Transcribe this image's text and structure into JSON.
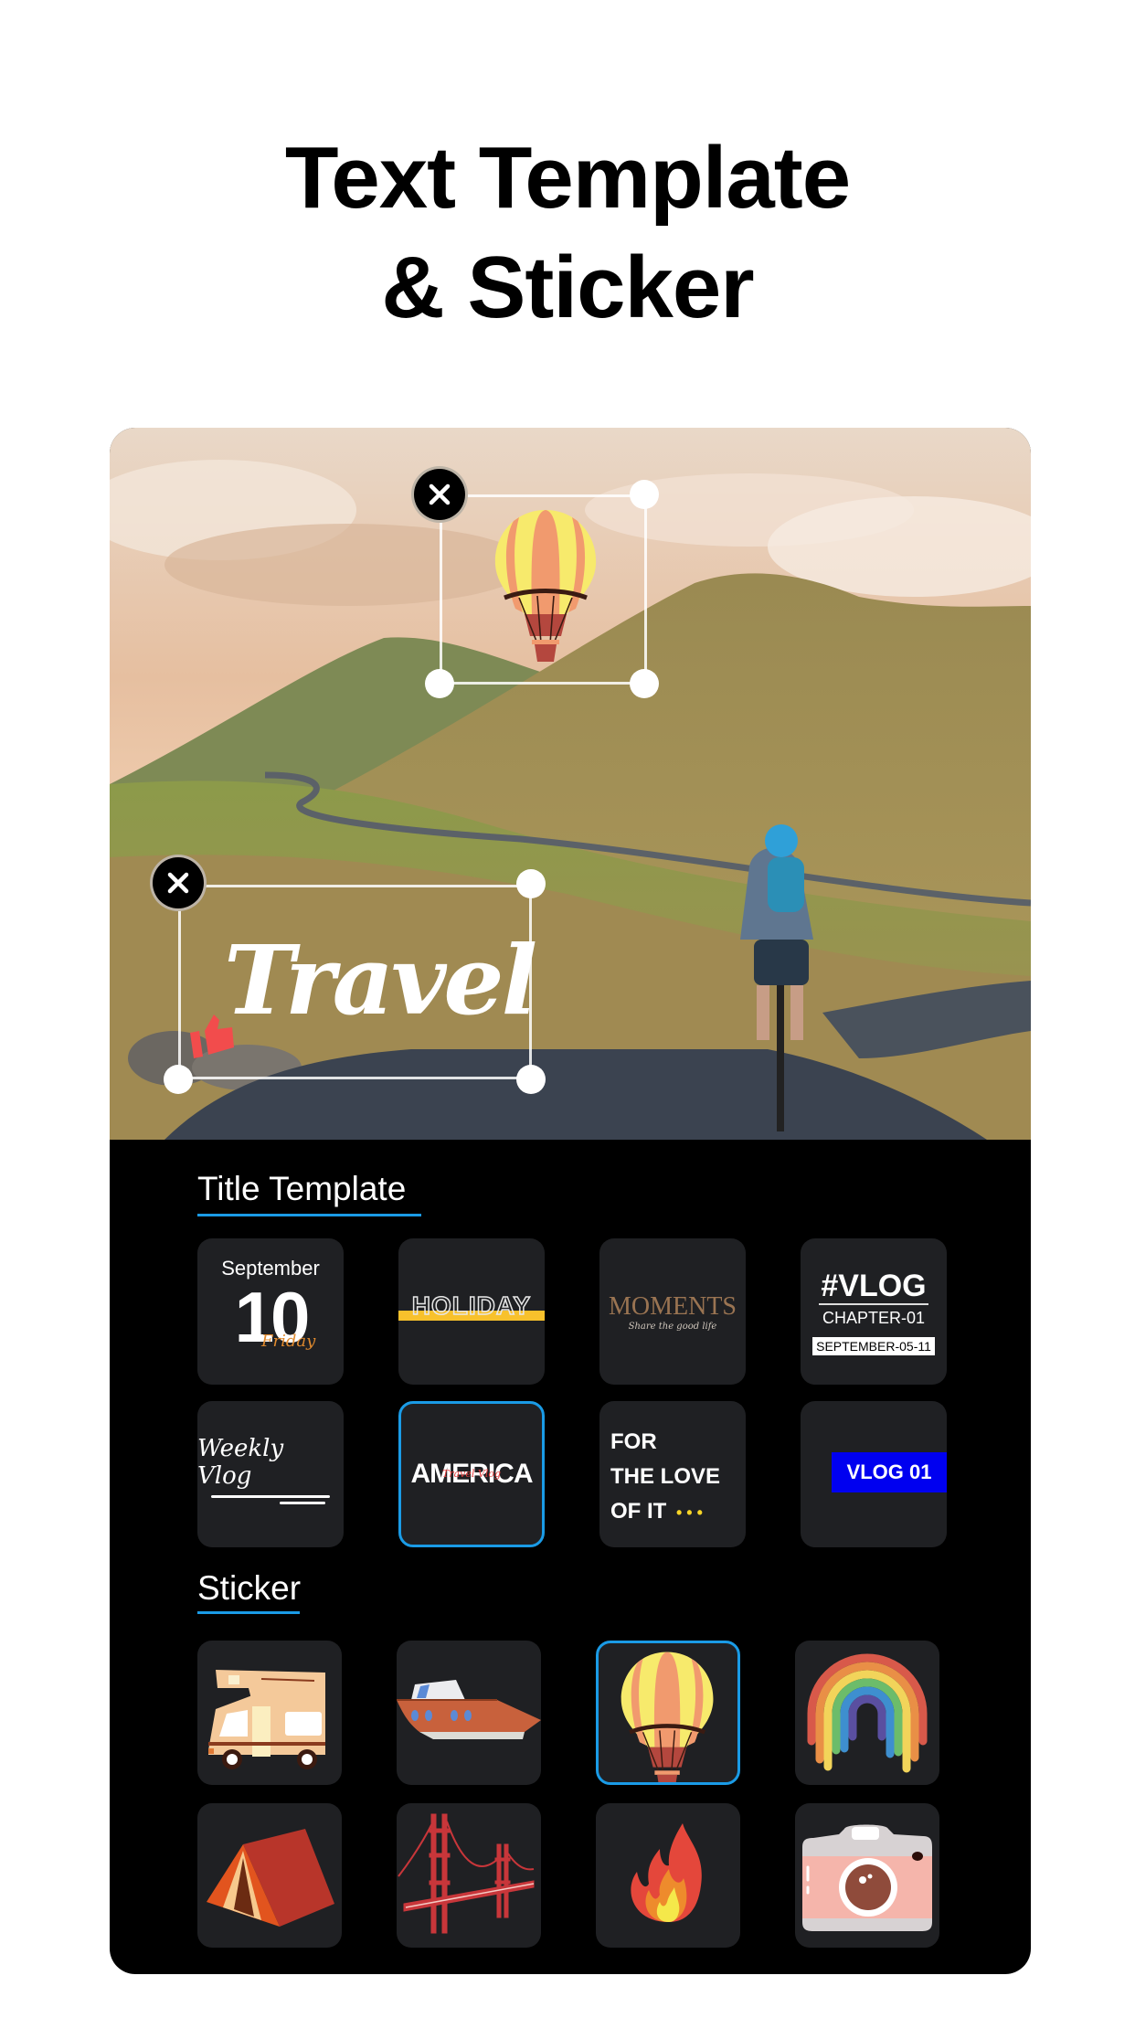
{
  "headline": {
    "line1": "Text Template",
    "line2": "& Sticker"
  },
  "canvas": {
    "text_overlay": "Travel",
    "sticker_overlay": "hot-air-balloon",
    "close_icon": "close-icon",
    "thumbs_up_icon": "thumbs-up-icon"
  },
  "colors": {
    "accent": "#1a9be6",
    "panel_bg": "#000000",
    "tile_bg": "#1f2023",
    "holiday_bar": "#f8c12c",
    "moments_gold": "#9a7452",
    "vlog01_bg": "#0000f0",
    "dots_yellow": "#f7d527",
    "friday_orange": "#e08a2e"
  },
  "title_template": {
    "heading": "Title Template",
    "items": [
      {
        "name": "september-10",
        "month": "September",
        "day": "10",
        "script": "Friday",
        "selected": false
      },
      {
        "name": "holiday",
        "text": "HOLIDAY",
        "selected": false
      },
      {
        "name": "moments",
        "text": "MOMENTS",
        "script": "Share the good life",
        "selected": false
      },
      {
        "name": "vlog-chapter",
        "hashtag": "#VLOG",
        "chapter": "CHAPTER-01",
        "date": "SEPTEMBER-05-11",
        "selected": false
      },
      {
        "name": "weekly-vlog",
        "script": "Weekly Vlog",
        "selected": false
      },
      {
        "name": "america",
        "text": "AMERICA",
        "script": "Travel Vlog",
        "selected": true
      },
      {
        "name": "for-the-love",
        "line1": "FOR",
        "line2": "THE LOVE",
        "line3": "OF IT",
        "dots": "• • •",
        "selected": false
      },
      {
        "name": "vlog-01",
        "text": "VLOG 01",
        "selected": false
      }
    ]
  },
  "sticker": {
    "heading": "Sticker",
    "items": [
      {
        "name": "camper-van",
        "icon": "camper-van-icon",
        "selected": false
      },
      {
        "name": "yacht",
        "icon": "yacht-icon",
        "selected": false
      },
      {
        "name": "hot-air-balloon",
        "icon": "hot-air-balloon-icon",
        "selected": true
      },
      {
        "name": "rainbow",
        "icon": "rainbow-icon",
        "selected": false
      },
      {
        "name": "tent",
        "icon": "tent-icon",
        "selected": false
      },
      {
        "name": "golden-gate-bridge",
        "icon": "bridge-icon",
        "selected": false
      },
      {
        "name": "fire",
        "icon": "fire-icon",
        "selected": false
      },
      {
        "name": "camera",
        "icon": "camera-icon",
        "selected": false
      }
    ]
  }
}
